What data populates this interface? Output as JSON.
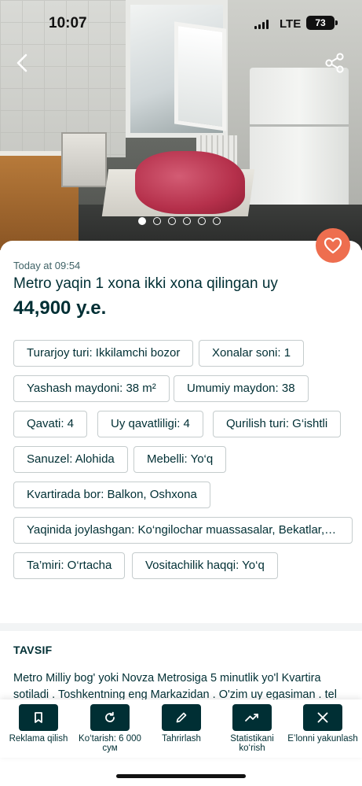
{
  "status_bar": {
    "time": "10:07",
    "network": "LTE",
    "battery": "73"
  },
  "gallery": {
    "photo_count": 6,
    "active_index": 0
  },
  "listing": {
    "posted": "Today at 09:54",
    "title": "Metro yaqin 1 xona ikki xona qilingan uy",
    "price": "44,900 y.e."
  },
  "attributes": [
    "Turarjoy turi: Ikkilamchi bozor",
    "Xonalar soni: 1",
    "Yashash maydoni: 38 m²",
    "Umumiy maydon: 38",
    "Qavati: 4",
    "Uy qavatliligi: 4",
    "Qurilish turi: G‘ishtli",
    "Sanuzel: Alohida",
    "Mebelli: Yo‘q",
    "Kvartirada bor: Balkon, Oshxona",
    "Yaqinida joylashgan: Ko‘ngilochar muassasalar, Bekatlar, Ma...",
    "Ta’miri: O‘rtacha",
    "Vositachilik haqqi: Yo‘q"
  ],
  "description": {
    "heading": "TAVSIF",
    "text": "Metro Milliy bog' yoki Novza Metrosiga 5 minutlik yo'l Kvartira sotiladi . Toshkentning eng Markazidan . O'zim uy egasiman . tel"
  },
  "actions": [
    {
      "label": "Reklama qilish",
      "icon": "bookmark-icon"
    },
    {
      "label": "Ko‘tarish: 6 000 сум",
      "icon": "refresh-icon"
    },
    {
      "label": "Tahrirlash",
      "icon": "pencil-icon"
    },
    {
      "label": "Statistikani ko‘rish",
      "icon": "trending-up-icon"
    },
    {
      "label": "E’lonni yakunlash",
      "icon": "close-icon"
    }
  ],
  "colors": {
    "accent": "#ee6e4f",
    "primary": "#002f34",
    "border": "#c5cccd"
  }
}
